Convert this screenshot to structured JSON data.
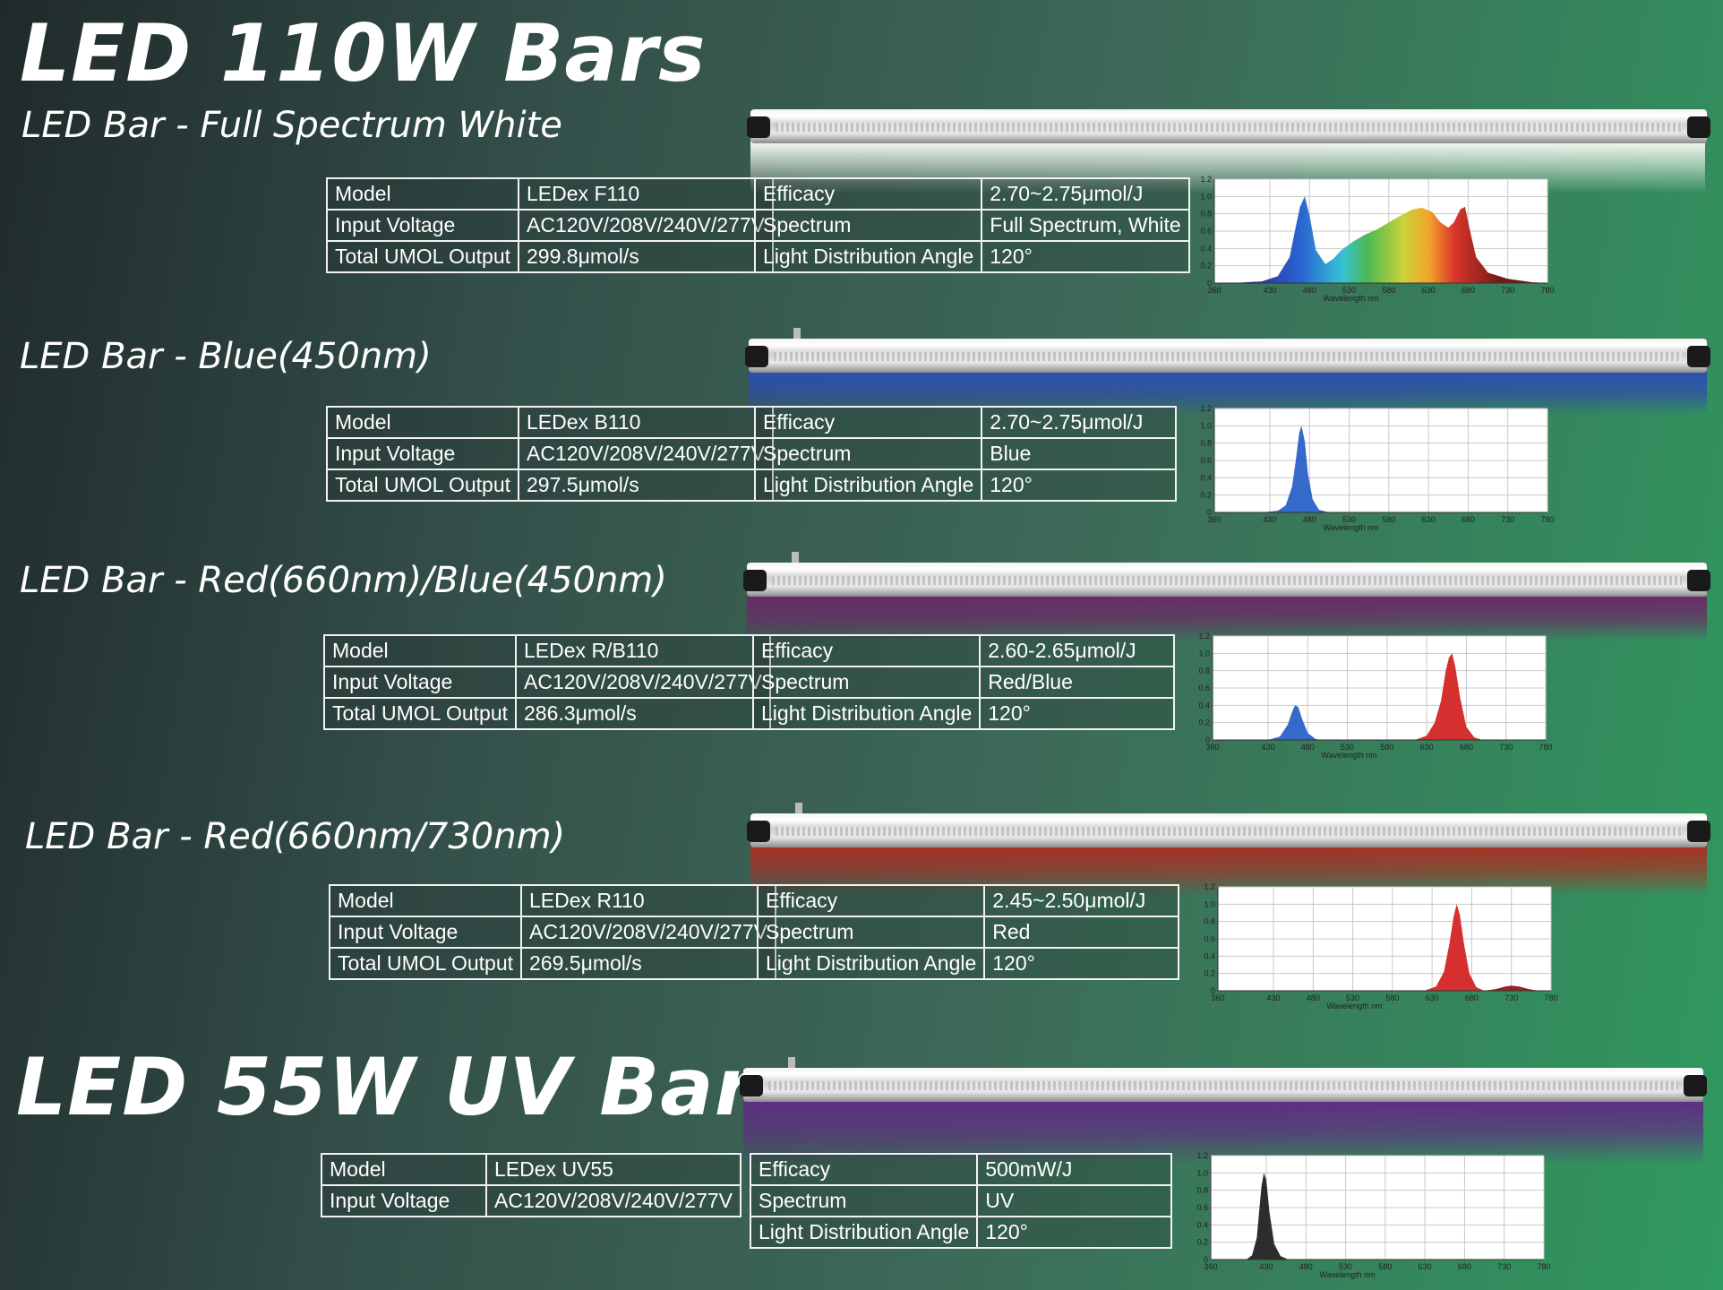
{
  "titles": {
    "main": "LED 110W Bars",
    "uv": "LED 55W UV Bar"
  },
  "labels": {
    "model": "Model",
    "input_voltage": "Input Voltage",
    "total_umol": "Total UMOL Output",
    "efficacy": "Efficacy",
    "spectrum": "Spectrum",
    "angle": "Light Distribution Angle"
  },
  "chart_axis": {
    "xlabel": "Wavelength  nm",
    "xticks": [
      "360",
      "430",
      "480",
      "530",
      "580",
      "630",
      "680",
      "730",
      "780"
    ],
    "yticks": [
      "0",
      "0.2",
      "0.4",
      "0.6",
      "0.8",
      "1.0",
      "1.2"
    ]
  },
  "products": [
    {
      "heading": "LED Bar - Full Spectrum White",
      "model": "LEDex F110",
      "voltage": "AC120V/208V/240V/277V",
      "umol": "299.8μmol/s",
      "efficacy": "2.70~2.75μmol/J",
      "spectrum": "Full Spectrum, White",
      "angle": "120°",
      "glow_color": "#f4f7ef"
    },
    {
      "heading": "LED Bar - Blue(450nm)",
      "model": "LEDex B110",
      "voltage": "AC120V/208V/240V/277V",
      "umol": "297.5μmol/s",
      "efficacy": "2.70~2.75μmol/J",
      "spectrum": "Blue",
      "angle": "120°",
      "glow_color": "#2e4fa8"
    },
    {
      "heading": "LED Bar - Red(660nm)/Blue(450nm)",
      "model": "LEDex R/B110",
      "voltage": "AC120V/208V/240V/277V",
      "umol": "286.3μmol/s",
      "efficacy": "2.60-2.65μmol/J",
      "spectrum": "Red/Blue",
      "angle": "120°",
      "glow_color": "#6a2a66"
    },
    {
      "heading": "LED Bar - Red(660nm/730nm)",
      "model": "LEDex R110",
      "voltage": "AC120V/208V/240V/277V",
      "umol": "269.5μmol/s",
      "efficacy": "2.45~2.50μmol/J",
      "spectrum": "Red",
      "angle": "120°",
      "glow_color": "#a83024"
    },
    {
      "heading": "",
      "model": "LEDex UV55",
      "voltage": "AC120V/208V/240V/277V",
      "umol": "",
      "efficacy": "500mW/J",
      "spectrum": "UV",
      "angle": "120°",
      "glow_color": "#5e2f82"
    }
  ],
  "chart_data": [
    {
      "type": "area",
      "xlabel": "Wavelength  nm",
      "xlim": [
        360,
        780
      ],
      "ylim": [
        0,
        1.2
      ],
      "series": [
        {
          "color": "spectrum-gradient",
          "x": [
            380,
            420,
            440,
            455,
            462,
            468,
            474,
            480,
            488,
            500,
            510,
            520,
            535,
            550,
            565,
            580,
            595,
            610,
            622,
            635,
            645,
            655,
            662,
            670,
            676,
            682,
            690,
            705,
            730,
            760,
            780
          ],
          "y": [
            0,
            0.02,
            0.08,
            0.3,
            0.62,
            0.88,
            1.0,
            0.78,
            0.38,
            0.22,
            0.28,
            0.38,
            0.48,
            0.56,
            0.62,
            0.7,
            0.78,
            0.85,
            0.87,
            0.82,
            0.7,
            0.64,
            0.7,
            0.85,
            0.88,
            0.62,
            0.3,
            0.12,
            0.05,
            0.01,
            0
          ]
        }
      ]
    },
    {
      "type": "area",
      "xlabel": "Wavelength  nm",
      "xlim": [
        360,
        780
      ],
      "ylim": [
        0,
        1.2
      ],
      "series": [
        {
          "color": "#2a62c8",
          "x": [
            420,
            440,
            450,
            458,
            463,
            467,
            470,
            474,
            478,
            484,
            492,
            505
          ],
          "y": [
            0,
            0.02,
            0.08,
            0.3,
            0.62,
            0.92,
            1.0,
            0.82,
            0.45,
            0.15,
            0.03,
            0
          ]
        }
      ]
    },
    {
      "type": "area",
      "xlabel": "Wavelength  nm",
      "xlim": [
        360,
        780
      ],
      "ylim": [
        0,
        1.2
      ],
      "series": [
        {
          "color": "#2a62c8",
          "x": [
            430,
            445,
            455,
            460,
            464,
            468,
            473,
            480,
            490,
            500
          ],
          "y": [
            0,
            0.04,
            0.18,
            0.32,
            0.4,
            0.38,
            0.24,
            0.08,
            0.01,
            0
          ]
        },
        {
          "color": "#d32424",
          "x": [
            615,
            630,
            640,
            648,
            654,
            658,
            662,
            666,
            672,
            680,
            690,
            700
          ],
          "y": [
            0,
            0.05,
            0.2,
            0.45,
            0.8,
            0.95,
            1.0,
            0.85,
            0.5,
            0.15,
            0.03,
            0
          ]
        }
      ]
    },
    {
      "type": "area",
      "xlabel": "Wavelength  nm",
      "xlim": [
        360,
        780
      ],
      "ylim": [
        0,
        1.2
      ],
      "series": [
        {
          "color": "#d32424",
          "x": [
            620,
            635,
            645,
            652,
            657,
            661,
            665,
            670,
            677,
            686,
            696
          ],
          "y": [
            0,
            0.05,
            0.22,
            0.55,
            0.85,
            1.0,
            0.88,
            0.55,
            0.2,
            0.04,
            0
          ]
        },
        {
          "color": "#8a1a14",
          "x": [
            695,
            710,
            722,
            730,
            740,
            752,
            765
          ],
          "y": [
            0,
            0.02,
            0.05,
            0.06,
            0.05,
            0.02,
            0
          ]
        }
      ]
    },
    {
      "type": "area",
      "xlabel": "Wavelength  nm",
      "xlim": [
        360,
        780
      ],
      "ylim": [
        0,
        1.2
      ],
      "series": [
        {
          "color": "#222222",
          "x": [
            405,
            412,
            418,
            421,
            424,
            427,
            430,
            434,
            440,
            448,
            458
          ],
          "y": [
            0,
            0.05,
            0.25,
            0.55,
            0.85,
            1.0,
            0.92,
            0.55,
            0.18,
            0.04,
            0
          ]
        }
      ]
    }
  ]
}
